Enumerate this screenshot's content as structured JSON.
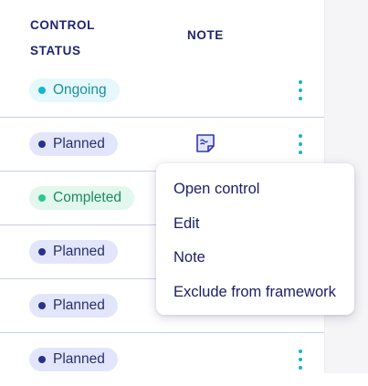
{
  "header": {
    "control_status": "CONTROL STATUS",
    "note": "NOTE"
  },
  "rows": [
    {
      "status": "Ongoing",
      "variant": "ongoing",
      "has_note": false,
      "has_menu": true
    },
    {
      "status": "Planned",
      "variant": "planned",
      "has_note": true,
      "has_menu": true
    },
    {
      "status": "Completed",
      "variant": "completed",
      "has_note": false,
      "has_menu": false
    },
    {
      "status": "Planned",
      "variant": "planned",
      "has_note": false,
      "has_menu": false
    },
    {
      "status": "Planned",
      "variant": "planned",
      "has_note": false,
      "has_menu": false
    },
    {
      "status": "Planned",
      "variant": "planned",
      "has_note": false,
      "has_menu": true
    }
  ],
  "context_menu": {
    "items": [
      "Open control",
      "Edit",
      "Note",
      "Exclude from framework"
    ]
  },
  "icons": {
    "kebab": "more-vertical-icon",
    "note": "sticky-note-icon"
  },
  "colors": {
    "header_text": "#1f2470",
    "accent_teal": "#14b5c4",
    "row_separator": "#c9cdf0",
    "planned_bg": "#e3e6fb",
    "ongoing_bg": "#e6f8fb",
    "completed_bg": "#e2f7ee"
  }
}
